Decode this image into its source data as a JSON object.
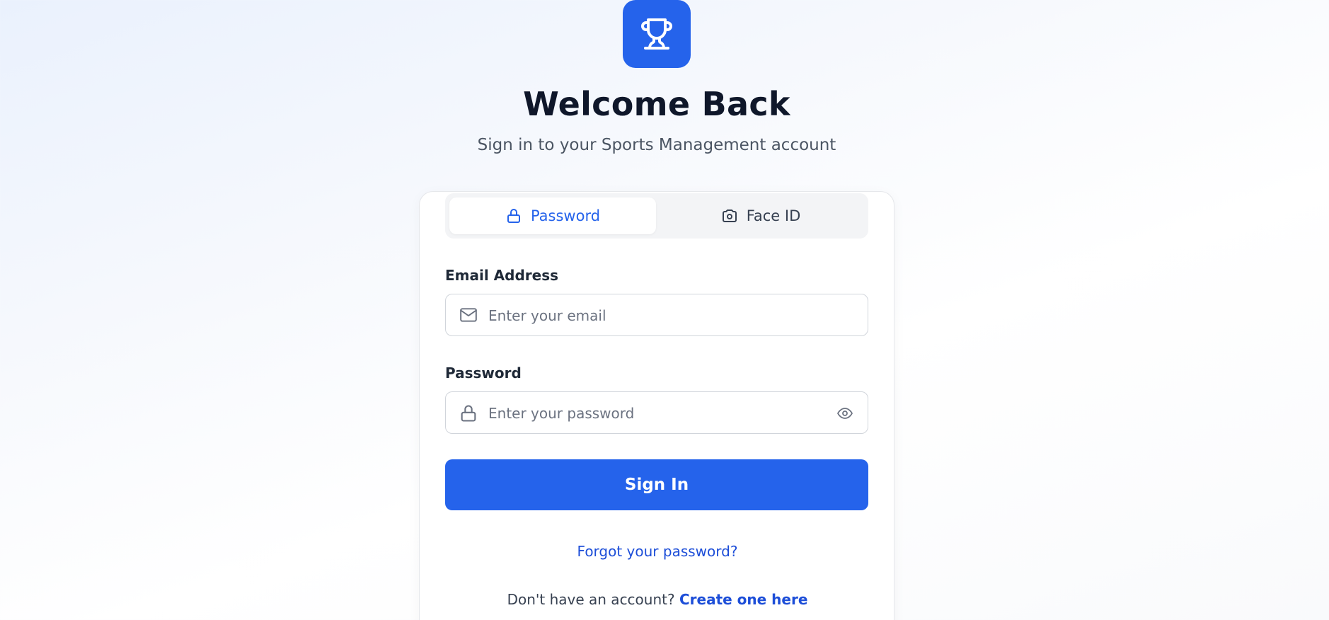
{
  "brand": {
    "logo_icon": "trophy-icon",
    "accent_color": "#2563eb"
  },
  "header": {
    "title": "Welcome Back",
    "subtitle": "Sign in to your Sports Management account"
  },
  "tabs": [
    {
      "label": "Password",
      "icon": "lock-icon",
      "active": true
    },
    {
      "label": "Face ID",
      "icon": "camera-icon",
      "active": false
    }
  ],
  "form": {
    "email": {
      "label": "Email Address",
      "placeholder": "Enter your email",
      "value": "",
      "icon": "mail-icon"
    },
    "password": {
      "label": "Password",
      "placeholder": "Enter your password",
      "value": "",
      "icon": "lock-icon",
      "toggle_icon": "eye-icon"
    },
    "submit_label": "Sign In"
  },
  "links": {
    "forgot": "Forgot your password?",
    "signup_prompt": "Don't have an account?",
    "signup_link": "Create one here"
  }
}
